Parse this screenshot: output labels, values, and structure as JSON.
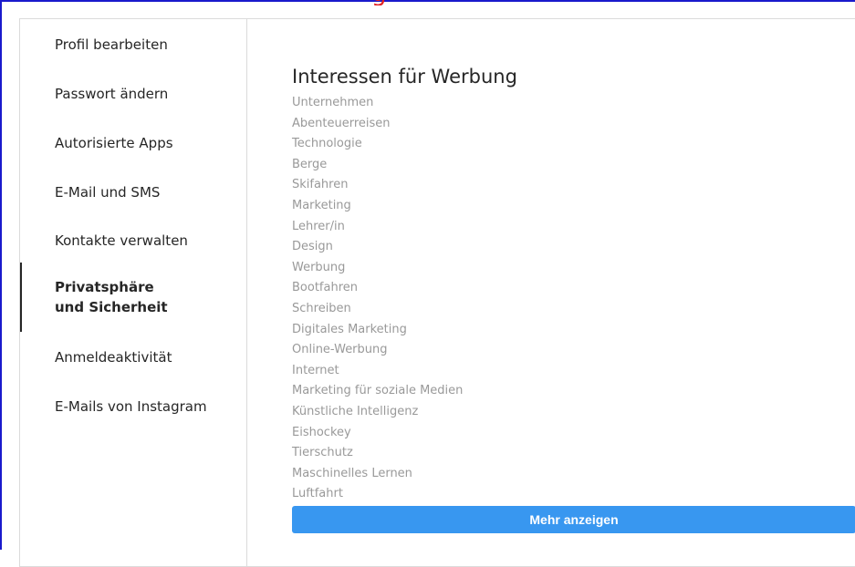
{
  "sidebar": {
    "items": [
      {
        "label": "Profil bearbeiten"
      },
      {
        "label": "Passwort ändern"
      },
      {
        "label": "Autorisierte Apps"
      },
      {
        "label": "E-Mail und SMS"
      },
      {
        "label": "Kontakte verwalten"
      },
      {
        "label": "Privatsphäre und Sicherheit",
        "active": true
      },
      {
        "label": "Anmeldeaktivität"
      },
      {
        "label": "E-Mails von Instagram"
      }
    ]
  },
  "main": {
    "title": "Interessen für Werbung",
    "interests": [
      "Unternehmen",
      "Abenteuerreisen",
      "Technologie",
      "Berge",
      "Skifahren",
      "Marketing",
      "Lehrer/in",
      "Design",
      "Werbung",
      "Bootfahren",
      "Schreiben",
      "Digitales Marketing",
      "Online-Werbung",
      "Internet",
      "Marketing für soziale Medien",
      "Künstliche Intelligenz",
      "Eishockey",
      "Tierschutz",
      "Maschinelles Lernen",
      "Luftfahrt"
    ],
    "more_button_label": "Mehr anzeigen"
  },
  "colors": {
    "accent": "#3897f0",
    "frame_border": "#1a1acc",
    "muted_text": "#999999"
  }
}
